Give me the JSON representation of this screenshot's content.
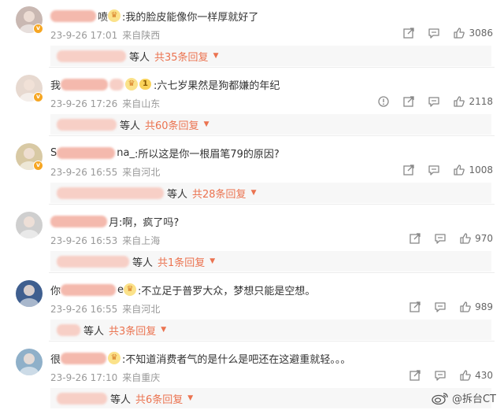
{
  "comments": [
    {
      "name_visible": "",
      "name_end": "喷",
      "has_crown": true,
      "level": "",
      "text": ":我的脸皮能像你一样厚就好了",
      "time": "23-9-26 17:01",
      "location": "来自陕西",
      "likes": "3086",
      "has_report": false,
      "reply_users": "等人",
      "reply_count": "共35条回复",
      "avatar_color": "#c9b8b2"
    },
    {
      "name_visible": "我",
      "name_end": "",
      "has_crown": true,
      "level": "1",
      "text": ":六七岁果然是狗都嫌的年纪",
      "time": "23-9-26 17:26",
      "location": "来自山东",
      "likes": "2118",
      "has_report": true,
      "reply_users": "等人",
      "reply_count": "共60条回复",
      "avatar_color": "#e7d9d0"
    },
    {
      "name_visible": "S",
      "name_end": "na_",
      "has_crown": false,
      "level": "",
      "text": ":所以这是你一根眉笔79的原因?",
      "time": "23-9-26 16:55",
      "location": "来自河北",
      "likes": "1008",
      "has_report": false,
      "reply_users": "等人",
      "reply_count": "共28条回复",
      "avatar_color": "#d8c9a4"
    },
    {
      "name_visible": "",
      "name_end": "月",
      "has_crown": false,
      "level": "",
      "text": ":啊，疯了吗?",
      "time": "23-9-26 16:53",
      "location": "来自上海",
      "likes": "970",
      "has_report": false,
      "reply_users": "等人",
      "reply_count": "共1条回复",
      "avatar_color": "#cfcfcf"
    },
    {
      "name_visible": "你",
      "name_end": "e",
      "has_crown": true,
      "level": "",
      "text": ":不立足于普罗大众，梦想只能是空想。",
      "time": "23-9-26 16:55",
      "location": "来自河北",
      "likes": "989",
      "has_report": false,
      "reply_users": "等人",
      "reply_count": "共3条回复",
      "avatar_color": "#3f5f8f"
    },
    {
      "name_visible": "很",
      "name_end": "",
      "has_crown": true,
      "level": "",
      "text": ":不知道消费者气的是什么是吧还在这避重就轻。。。",
      "time": "23-9-26 17:10",
      "location": "来自重庆",
      "likes": "430",
      "has_report": false,
      "reply_users": "等人",
      "reply_count": "共6条回复",
      "avatar_color": "#8fb0c9"
    }
  ],
  "watermark": {
    "text": "@拆台CT"
  },
  "icons": {
    "share": "share-icon",
    "comment": "comment-icon",
    "like": "like-icon",
    "report": "report-icon"
  },
  "colors": {
    "reply_count": "#eb7350",
    "meta": "#999999"
  }
}
